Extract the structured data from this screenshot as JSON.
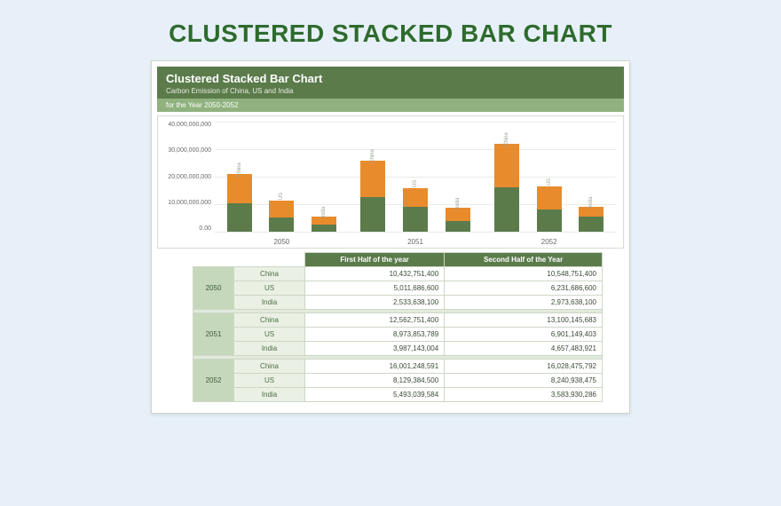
{
  "page_title": "CLUSTERED STACKED BAR CHART",
  "header": {
    "title": "Clustered Stacked Bar Chart",
    "subtitle": "Carbon Emission of China, US and India",
    "band": "for the Year 2050-2052"
  },
  "chart_data": {
    "type": "bar",
    "stacked": true,
    "ylabel": "",
    "ylim": [
      0,
      40000000000
    ],
    "yticks": [
      "40,000,000,000",
      "30,000,000,000",
      "20,000,000,000",
      "10,000,000,000",
      "0.00"
    ],
    "groups": [
      "2050",
      "2051",
      "2052"
    ],
    "countries": [
      "China",
      "US",
      "India"
    ],
    "series": [
      {
        "name": "First Half of the year",
        "color": "#5b7b4b"
      },
      {
        "name": "Second Half of the Year",
        "color": "#e88b2d"
      }
    ],
    "data": {
      "2050": {
        "China": [
          10432751400,
          10548751400
        ],
        "US": [
          5011686600,
          6231686600
        ],
        "India": [
          2533638100,
          2973638100
        ]
      },
      "2051": {
        "China": [
          12562751400,
          13100145683
        ],
        "US": [
          8973853789,
          6901149403
        ],
        "India": [
          3987143004,
          4657483921
        ]
      },
      "2052": {
        "China": [
          16001248591,
          16028475792
        ],
        "US": [
          8129384500,
          8240938475
        ],
        "India": [
          5493039584,
          3583930286
        ]
      }
    }
  },
  "table": {
    "col1": "First Half of the year",
    "col2": "Second Half of the Year",
    "rows": [
      {
        "year": "2050",
        "country": "China",
        "h1": "10,432,751,400",
        "h2": "10,548,751,400"
      },
      {
        "year": "2050",
        "country": "US",
        "h1": "5,011,686,600",
        "h2": "6,231,686,600"
      },
      {
        "year": "2050",
        "country": "India",
        "h1": "2,533,638,100",
        "h2": "2,973,638,100"
      },
      {
        "year": "2051",
        "country": "China",
        "h1": "12,562,751,400",
        "h2": "13,100,145,683"
      },
      {
        "year": "2051",
        "country": "US",
        "h1": "8,973,853,789",
        "h2": "6,901,149,403"
      },
      {
        "year": "2051",
        "country": "India",
        "h1": "3,987,143,004",
        "h2": "4,657,483,921"
      },
      {
        "year": "2052",
        "country": "China",
        "h1": "16,001,248,591",
        "h2": "16,028,475,792"
      },
      {
        "year": "2052",
        "country": "US",
        "h1": "8,129,384,500",
        "h2": "8,240,938,475"
      },
      {
        "year": "2052",
        "country": "India",
        "h1": "5,493,039,584",
        "h2": "3,583,930,286"
      }
    ]
  }
}
